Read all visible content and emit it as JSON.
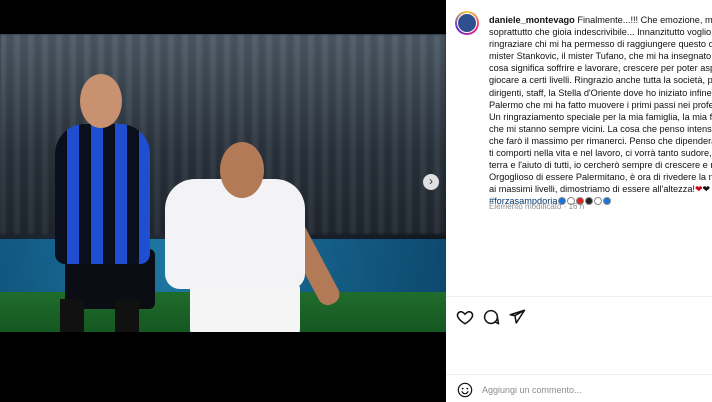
{
  "post": {
    "username": "daniele_montevago",
    "caption_lines": [
      "Finalmente...!!! Che emozione, ma",
      "soprattutto che gioia indescrivibile... Innanzitutto voglio",
      "ringraziare chi mi ha permesso di raggiungere questo ob",
      "mister Stankovic, il mister Tufano, che mi ha insegnato ta",
      "cosa significa soffrire e lavorare, crescere per poter aspira",
      "giocare a certi livelli. Ringrazio anche tutta la società, pres",
      "dirigenti, staff, la Stella d'Oriente dove ho iniziato infine il",
      "Palermo che mi ha fatto muovere i primi passi nei profess",
      "Un ringraziamento speciale per la mia famiglia, la mia fida",
      "che mi stanno sempre vicini. La cosa che penso intensam",
      "che farò il massimo per rimanerci. Penso che dipenderà d",
      "ti comporti nella vita e nel lavoro, ci vorrà tanto sudore, p",
      "terra e l'aiuto di tutti, io cercherò sempre di crescere e mi",
      "Orgoglioso di essere Palermitano, è ora di rivedere la nos",
      "ai massimi livelli, dimostriamo di essere all'altezza!"
    ],
    "hashtag": "#forzasampdoria",
    "hashtag_dot_colors": [
      "#1a73d9",
      "#ffffff",
      "#e0221b",
      "#222222",
      "#ffffff",
      "#1a73d9"
    ],
    "edited_label": "Elemento modificato",
    "time_ago": "16 h",
    "comment_placeholder": "Aggiungi un commento..."
  },
  "icons": {
    "like": "heart-outline-icon",
    "comment": "comment-bubble-icon",
    "share": "paper-plane-icon",
    "emoji": "emoji-smile-icon",
    "next": "chevron-right-icon"
  },
  "colors": {
    "hashtag": "#00376b",
    "meta": "#8e8e8e"
  }
}
